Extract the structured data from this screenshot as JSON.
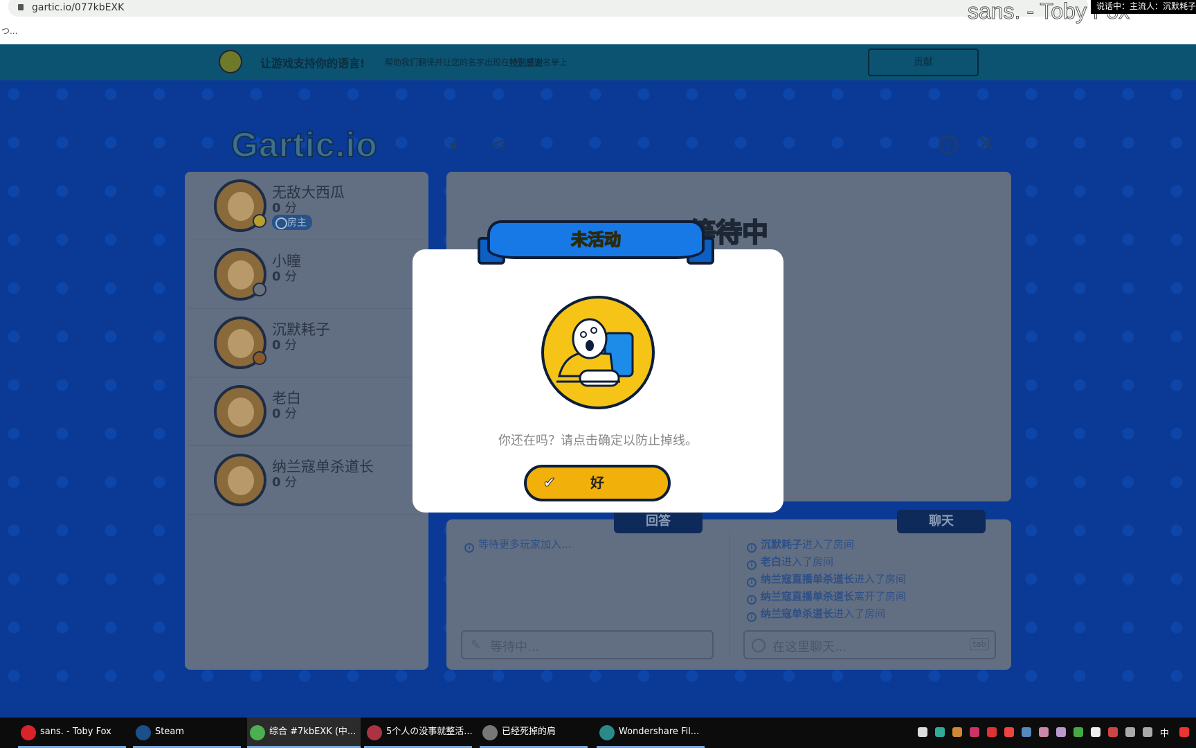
{
  "browser": {
    "url": "gartic.io/077kbEXK",
    "loading_text": "つ..."
  },
  "overlay": {
    "music_title": "sans. - Toby Fox",
    "speaking": "说话中：主流人：沉默耗子"
  },
  "banner": {
    "title": "让游戏支持你的语言!",
    "desc_prefix": "帮助我们翻译并让您的名字出现在",
    "desc_link": "特别感谢",
    "desc_suffix": "名单上",
    "button": "贡献"
  },
  "header": {
    "logo": "Gartic.io",
    "icons": [
      "speaker-icon",
      "share-icon",
      "info-icon",
      "close-icon"
    ]
  },
  "players": [
    {
      "name": "无敌大西瓜",
      "score": "0",
      "unit": "分",
      "badge": "房主",
      "dot": "#b8a030"
    },
    {
      "name": "小瞳",
      "score": "0",
      "unit": "分",
      "dot": "#6b7380"
    },
    {
      "name": "沉默耗子",
      "score": "0",
      "unit": "分",
      "dot": "#8a5a2a"
    },
    {
      "name": "老白",
      "score": "0",
      "unit": "分"
    },
    {
      "name": "纳兰寇单杀道长",
      "score": "0",
      "unit": "分"
    }
  ],
  "main": {
    "status": "等待中"
  },
  "answers": {
    "tab": "回答",
    "message": "等待更多玩家加入...",
    "placeholder": "等待中..."
  },
  "chat": {
    "tab": "聊天",
    "placeholder": "在这里聊天...",
    "key_hint": "tab",
    "messages": [
      {
        "name": "沉默耗子",
        "action": "进入了房间"
      },
      {
        "name": "老白",
        "action": "进入了房间"
      },
      {
        "name": "纳兰寇直播单杀道长",
        "action": "进入了房间"
      },
      {
        "name": "纳兰寇直播单杀道长",
        "action": "离开了房间"
      },
      {
        "name": "纳兰寇单杀道长",
        "action": "进入了房间"
      }
    ]
  },
  "modal": {
    "title": "未活动",
    "message": "你还在吗？请点击确定以防止掉线。",
    "ok": "好"
  },
  "taskbar": {
    "items": [
      {
        "label": "sans. - Toby Fox",
        "color": "#d8232a"
      },
      {
        "label": "Steam",
        "color": "#1b4f8a"
      },
      {
        "label": "综合 #7kbEXK (中...",
        "color": "#4caf50",
        "active": true
      },
      {
        "label": "5个人の没事就整活...",
        "color": "#aa3344"
      },
      {
        "label": "已经死掉的肩",
        "color": "#777"
      },
      {
        "label": "Wondershare Fil...",
        "color": "#2a8a8a"
      }
    ],
    "ime": "中"
  },
  "colors": {
    "accent_yellow": "#f2b00a",
    "ribbon_blue": "#1779e6",
    "banner": "#0b5370"
  }
}
